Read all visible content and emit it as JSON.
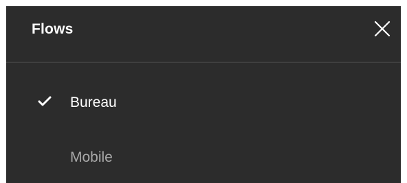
{
  "panel": {
    "title": "Flows",
    "close_icon": "close-icon",
    "items": [
      {
        "label": "Bureau",
        "selected": true,
        "icon": "checkmark-icon"
      },
      {
        "label": "Mobile",
        "selected": false
      }
    ]
  },
  "colors": {
    "background": "#2c2c2c",
    "divider": "#3f3f3f",
    "text": "#ffffff",
    "muted_text": "#a9a9a9"
  }
}
